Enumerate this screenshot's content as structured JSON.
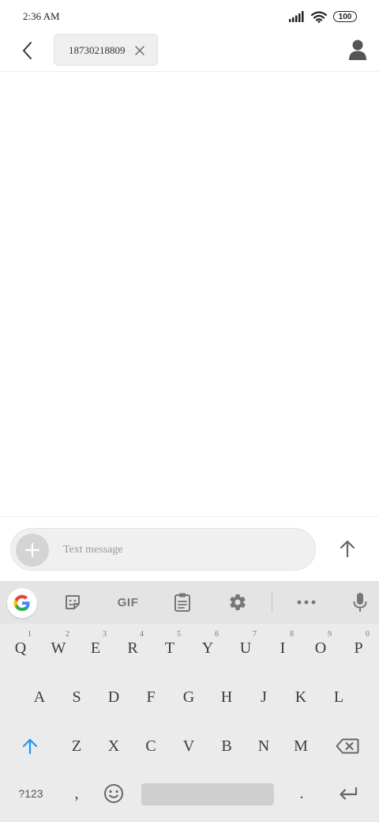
{
  "status_bar": {
    "time": "2:36 AM",
    "battery": "100"
  },
  "header": {
    "recipient": "18730218809"
  },
  "compose": {
    "placeholder": "Text message"
  },
  "keyboard": {
    "toolbar": {
      "gif_label": "GIF"
    },
    "row1": [
      {
        "label": "Q",
        "hint": "1"
      },
      {
        "label": "W",
        "hint": "2"
      },
      {
        "label": "E",
        "hint": "3"
      },
      {
        "label": "R",
        "hint": "4"
      },
      {
        "label": "T",
        "hint": "5"
      },
      {
        "label": "Y",
        "hint": "6"
      },
      {
        "label": "U",
        "hint": "7"
      },
      {
        "label": "I",
        "hint": "8"
      },
      {
        "label": "O",
        "hint": "9"
      },
      {
        "label": "P",
        "hint": "0"
      }
    ],
    "row2": [
      "A",
      "S",
      "D",
      "F",
      "G",
      "H",
      "J",
      "K",
      "L"
    ],
    "row3": [
      "Z",
      "X",
      "C",
      "V",
      "B",
      "N",
      "M"
    ],
    "row4": {
      "symbols": "?123",
      "comma": ",",
      "period": "."
    }
  },
  "colors": {
    "accent": "#2196f3",
    "keyboard_bg": "#ebebeb",
    "toolbar_bg": "#e4e4e4"
  }
}
